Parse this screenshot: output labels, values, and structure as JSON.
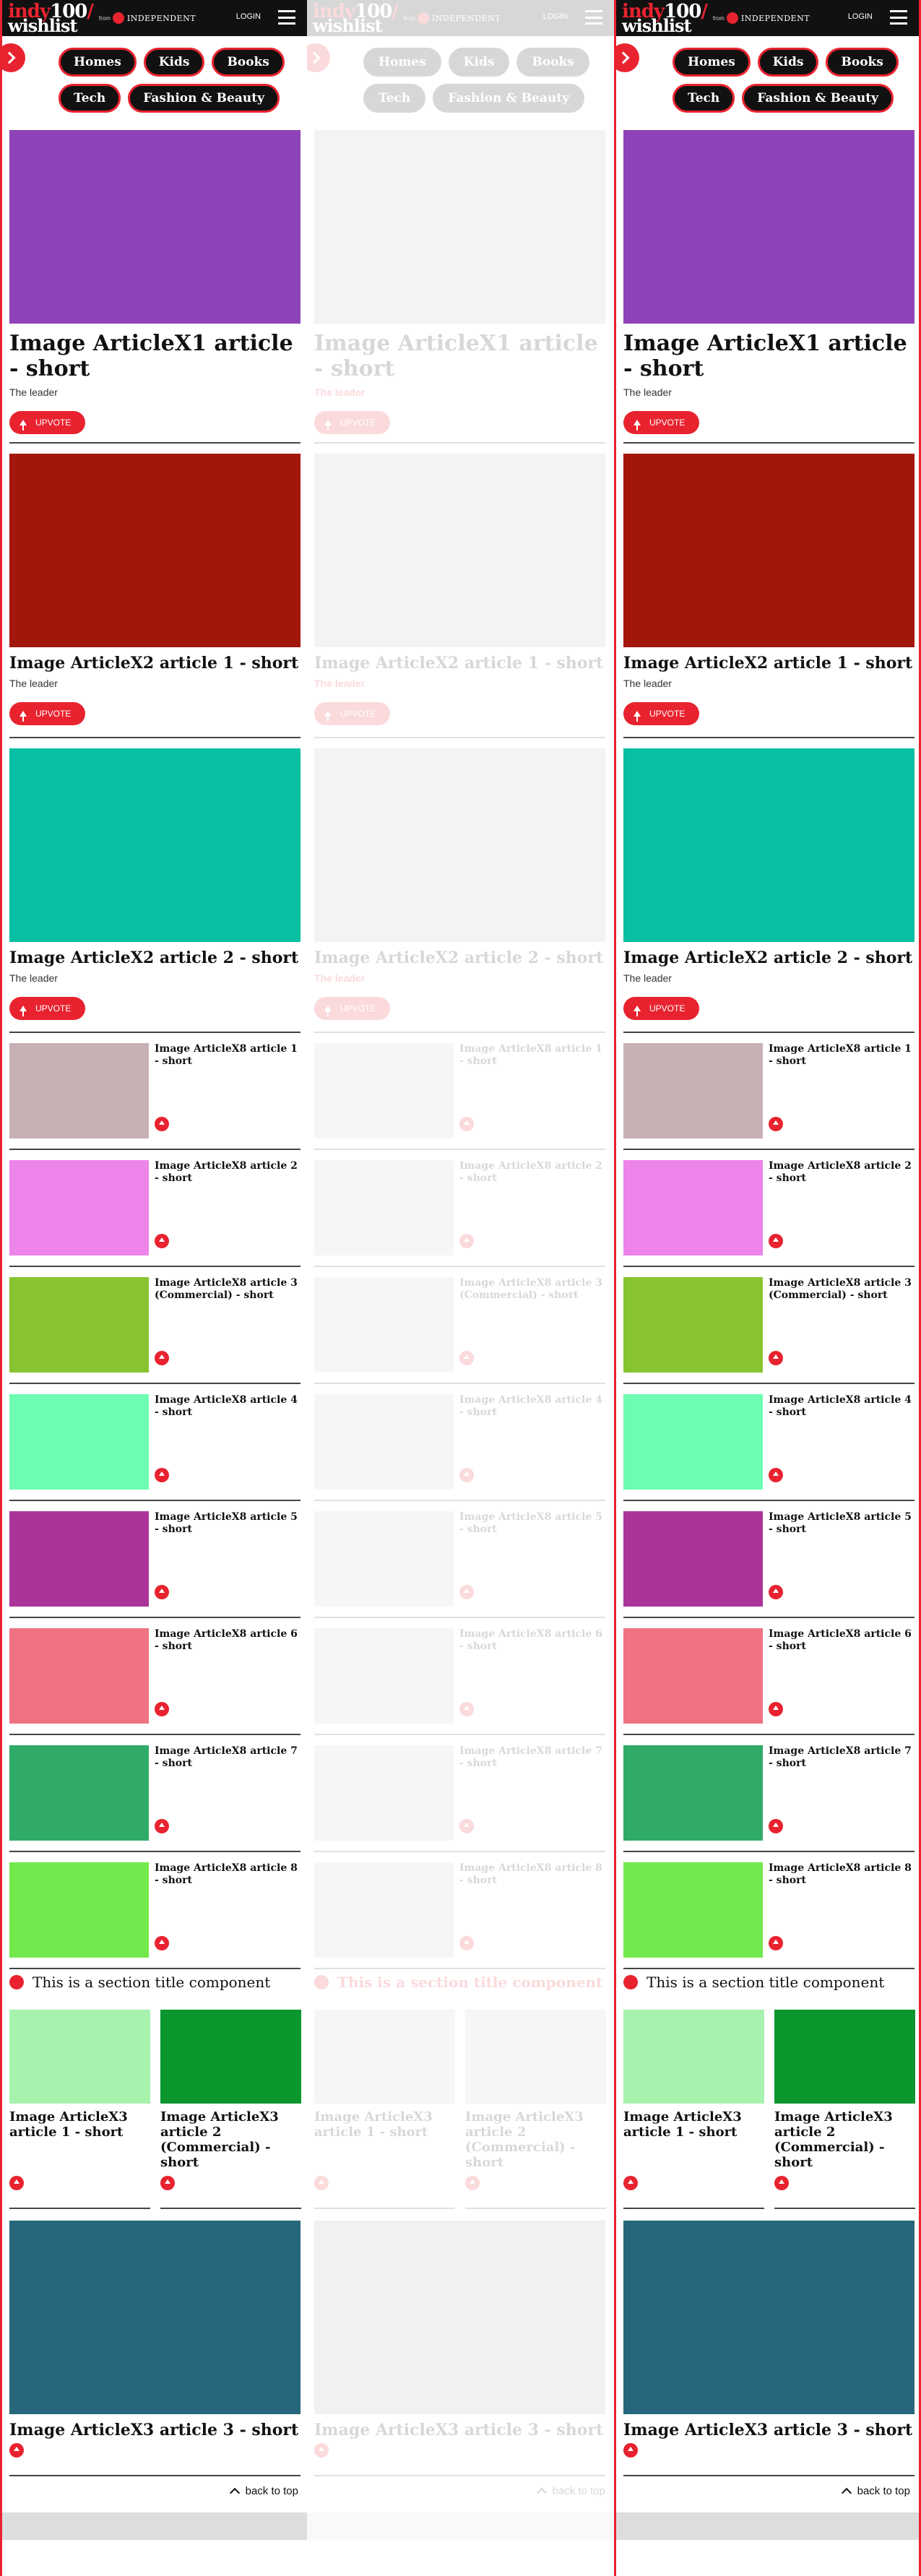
{
  "header": {
    "logo_part1": "indy",
    "logo_part2": "100",
    "logo_part3": "/",
    "logo_part4": "wishlist",
    "from_label": "from",
    "publisher": "INDEPENDENT",
    "login_label": "LOGIN",
    "menu_icon": "hamburger-icon"
  },
  "nav": {
    "scroll_button_icon": "chevron-right-icon",
    "pills": [
      {
        "label": "Homes"
      },
      {
        "label": "Kids"
      },
      {
        "label": "Books"
      },
      {
        "label": "Tech"
      },
      {
        "label": "Fashion & Beauty"
      }
    ]
  },
  "colors": {
    "accent": "#e8232f",
    "dark": "#111111",
    "x1_image": "#8e44b8",
    "x2a_image": "#a3160b",
    "x2b_image": "#08bea3",
    "x8_images": [
      "#c8b1b5",
      "#ec84e9",
      "#88c430",
      "#6efcb2",
      "#ab3499",
      "#ef7382",
      "#30ab67",
      "#72ea4d"
    ],
    "x3_images": [
      "#a7f2ad",
      "#0b962e",
      "#26677b"
    ]
  },
  "featured": [
    {
      "title": "Image ArticleX1 article - short",
      "leader": "The leader",
      "upvote_label": "UPVOTE"
    },
    {
      "title": "Image ArticleX2 article 1 - short",
      "leader": "The leader",
      "upvote_label": "UPVOTE"
    },
    {
      "title": "Image ArticleX2 article 2 - short",
      "leader": "The leader",
      "upvote_label": "UPVOTE"
    }
  ],
  "x8_articles": [
    {
      "title": "Image ArticleX8 article 1 - short"
    },
    {
      "title": "Image ArticleX8 article 2 - short"
    },
    {
      "title": "Image ArticleX8 article 3 (Commercial) - short"
    },
    {
      "title": "Image ArticleX8 article 4 - short"
    },
    {
      "title": "Image ArticleX8 article 5 - short"
    },
    {
      "title": "Image ArticleX8 article 6 - short"
    },
    {
      "title": "Image ArticleX8 article 7 - short"
    },
    {
      "title": "Image ArticleX8 article 8 - short"
    }
  ],
  "section_title": "This is a section title component",
  "x3_articles": [
    {
      "title": "Image ArticleX3 article 1 - short"
    },
    {
      "title": "Image ArticleX3 article 2 (Commercial) - short"
    },
    {
      "title": "Image ArticleX3 article 3 - short"
    }
  ],
  "back_to_top": "back to top"
}
